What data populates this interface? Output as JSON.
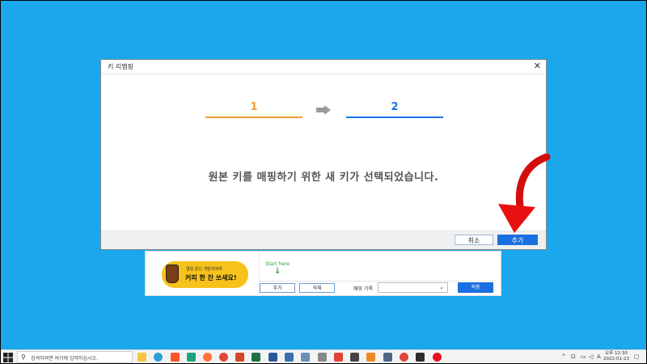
{
  "dialog": {
    "title": "키 리맵핑",
    "step1": "1",
    "step2": "2",
    "message": "원본 키를 매핑하기 위한 새 키가 선택되었습니다.",
    "cancel_label": "취소",
    "ok_label": "추가"
  },
  "panel": {
    "banner_line1": "열일 중인 개발자에게",
    "banner_line2": "커피 한 잔 쏘세요!",
    "start_here": "Start here",
    "add_label": "추가",
    "delete_label": "삭제",
    "record_label": "매핑 기록",
    "record_value": "",
    "apply_label": "적용"
  },
  "taskbar": {
    "search_placeholder": "검색하려면 여기에 입력하십시오.",
    "tray_lang": "A",
    "time": "오후 12:30",
    "date": "2022-01-23"
  },
  "colors": {
    "desktop": "#1aa7ec",
    "step1": "#f29c2b",
    "step2": "#1e74e6",
    "primary_button": "#1a6fe3",
    "highlight_arrow": "#e81010",
    "banner": "#f7c21b"
  },
  "icons": [
    "close-icon",
    "right-arrow-icon",
    "coffee-cup-icon",
    "down-arrow-icon",
    "chevron-down-icon",
    "windows-start-icon",
    "search-icon"
  ]
}
